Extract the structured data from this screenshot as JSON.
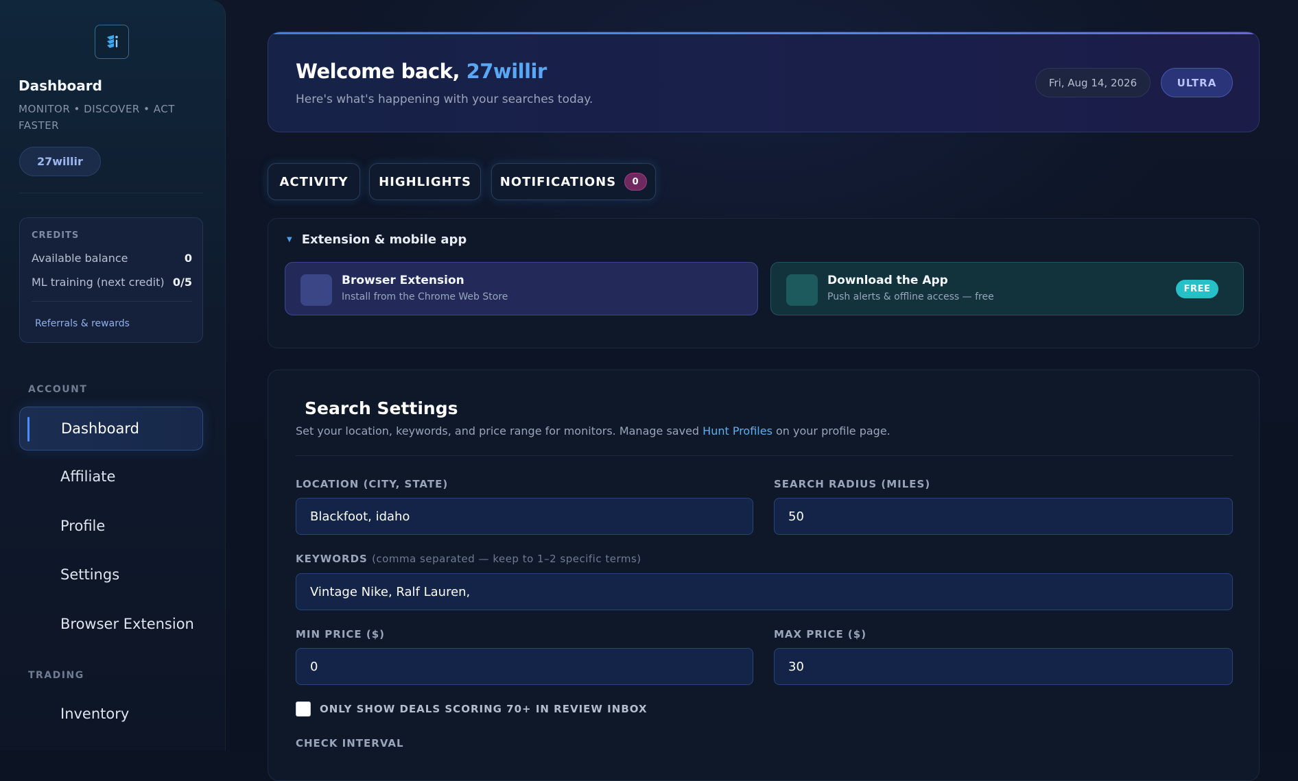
{
  "sidebar": {
    "title": "Dashboard",
    "tagline": "MONITOR • DISCOVER • ACT FASTER",
    "user": "27willir",
    "credits": {
      "caption": "CREDITS",
      "balance_label": "Available balance",
      "balance_value": "0",
      "ml_label": "ML training (next credit)",
      "ml_value": "0/5",
      "referrals_link": "Referrals & rewards"
    },
    "sections": {
      "account": "ACCOUNT",
      "trading": "TRADING"
    },
    "nav": [
      {
        "label": "Dashboard",
        "active": true
      },
      {
        "label": "Affiliate"
      },
      {
        "label": "Profile"
      },
      {
        "label": "Settings"
      },
      {
        "label": "Browser Extension"
      },
      {
        "label": "Inventory"
      }
    ]
  },
  "header": {
    "welcome_prefix": "Welcome back, ",
    "username": "27willir",
    "subtitle": "Here's what's happening with your searches today.",
    "date": "Fri, Aug 14, 2026",
    "plan": "ULTRA"
  },
  "tabs": [
    {
      "label": "ACTIVITY"
    },
    {
      "label": "HIGHLIGHTS"
    },
    {
      "label": "NOTIFICATIONS",
      "badge": "0"
    }
  ],
  "extension_panel": {
    "title": "Extension & mobile app",
    "browser_card": {
      "title": "Browser Extension",
      "desc": "Install from the Chrome Web Store"
    },
    "app_card": {
      "title": "Download the App",
      "desc": "Push alerts & offline access — free",
      "badge": "FREE"
    }
  },
  "search_settings": {
    "title": "Search Settings",
    "desc_before": "Set your location, keywords, and price range for monitors. Manage saved ",
    "desc_link": "Hunt Profiles",
    "desc_after": " on your profile page.",
    "location_label": "LOCATION (CITY, STATE)",
    "location_value": "Blackfoot, idaho",
    "radius_label": "SEARCH RADIUS (MILES)",
    "radius_value": "50",
    "keywords_label": "KEYWORDS",
    "keywords_hint": "(comma separated — keep to 1–2 specific terms)",
    "keywords_value": "Vintage Nike, Ralf Lauren,",
    "min_price_label": "MIN PRICE ($)",
    "min_price_value": "0",
    "max_price_label": "MAX PRICE ($)",
    "max_price_value": "30",
    "only_deals_label": "ONLY SHOW DEALS SCORING 70+ IN REVIEW INBOX",
    "only_deals_checked": false,
    "check_interval_label": "CHECK INTERVAL"
  },
  "colors": {
    "accent": "#5aa8f5",
    "link": "#5ab0f0",
    "free_badge": "#26c0c8",
    "notif_badge": "#6e2a5e"
  },
  "icons": [
    "app-logo-icon",
    "caret-down-icon",
    "browser-extension-icon",
    "mobile-app-icon"
  ]
}
